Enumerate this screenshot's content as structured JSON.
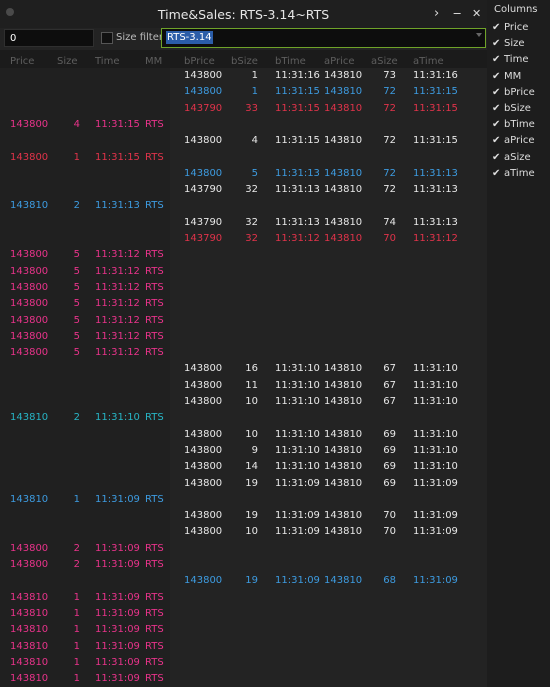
{
  "window": {
    "title": "Time&Sales: RTS-3.14~RTS",
    "chevron": "›",
    "minimize": "‒",
    "close": "✕"
  },
  "toolbar": {
    "price_value": "0",
    "size_filter_label": "Size filter",
    "symbol_value": "RTS-3.14"
  },
  "columns_panel": {
    "title": "Columns",
    "items": [
      {
        "label": "Price",
        "checked": true
      },
      {
        "label": "Size",
        "checked": true
      },
      {
        "label": "Time",
        "checked": true
      },
      {
        "label": "MM",
        "checked": true
      },
      {
        "label": "bPrice",
        "checked": true
      },
      {
        "label": "bSize",
        "checked": true
      },
      {
        "label": "bTime",
        "checked": true
      },
      {
        "label": "aPrice",
        "checked": true
      },
      {
        "label": "aSize",
        "checked": true
      },
      {
        "label": "aTime",
        "checked": true
      }
    ]
  },
  "headers": [
    "Price",
    "Size",
    "Time",
    "MM",
    "bPrice",
    "bSize",
    "bTime",
    "aPrice",
    "aSize",
    "aTime"
  ],
  "colors": {
    "white": "#e8e8e8",
    "blue": "#3d9be0",
    "red": "#e0334a",
    "magenta": "#e8338a",
    "cyan": "#27b4c4"
  },
  "rows": [
    {
      "kind": "q",
      "color": "white",
      "v": [
        "143800",
        "1",
        "11:31:16",
        "143810",
        "73",
        "11:31:16"
      ]
    },
    {
      "kind": "q",
      "color": "blue",
      "v": [
        "143800",
        "1",
        "11:31:15",
        "143810",
        "72",
        "11:31:15"
      ]
    },
    {
      "kind": "q",
      "color": "red",
      "v": [
        "143790",
        "33",
        "11:31:15",
        "143810",
        "72",
        "11:31:15"
      ]
    },
    {
      "kind": "t",
      "color": "magenta",
      "v": [
        "143800",
        "4",
        "11:31:15",
        "RTS"
      ]
    },
    {
      "kind": "q",
      "color": "white",
      "v": [
        "143800",
        "4",
        "11:31:15",
        "143810",
        "72",
        "11:31:15"
      ]
    },
    {
      "kind": "t",
      "color": "red",
      "v": [
        "143800",
        "1",
        "11:31:15",
        "RTS"
      ]
    },
    {
      "kind": "q",
      "color": "blue",
      "v": [
        "143800",
        "5",
        "11:31:13",
        "143810",
        "72",
        "11:31:13"
      ]
    },
    {
      "kind": "q",
      "color": "white",
      "v": [
        "143790",
        "32",
        "11:31:13",
        "143810",
        "72",
        "11:31:13"
      ]
    },
    {
      "kind": "t",
      "color": "blue",
      "v": [
        "143810",
        "2",
        "11:31:13",
        "RTS"
      ]
    },
    {
      "kind": "q",
      "color": "white",
      "v": [
        "143790",
        "32",
        "11:31:13",
        "143810",
        "74",
        "11:31:13"
      ]
    },
    {
      "kind": "q",
      "color": "red",
      "v": [
        "143790",
        "32",
        "11:31:12",
        "143810",
        "70",
        "11:31:12"
      ]
    },
    {
      "kind": "t",
      "color": "magenta",
      "v": [
        "143800",
        "5",
        "11:31:12",
        "RTS"
      ]
    },
    {
      "kind": "t",
      "color": "magenta",
      "v": [
        "143800",
        "5",
        "11:31:12",
        "RTS"
      ]
    },
    {
      "kind": "t",
      "color": "magenta",
      "v": [
        "143800",
        "5",
        "11:31:12",
        "RTS"
      ]
    },
    {
      "kind": "t",
      "color": "magenta",
      "v": [
        "143800",
        "5",
        "11:31:12",
        "RTS"
      ]
    },
    {
      "kind": "t",
      "color": "magenta",
      "v": [
        "143800",
        "5",
        "11:31:12",
        "RTS"
      ]
    },
    {
      "kind": "t",
      "color": "magenta",
      "v": [
        "143800",
        "5",
        "11:31:12",
        "RTS"
      ]
    },
    {
      "kind": "t",
      "color": "magenta",
      "v": [
        "143800",
        "5",
        "11:31:12",
        "RTS"
      ]
    },
    {
      "kind": "q",
      "color": "white",
      "v": [
        "143800",
        "16",
        "11:31:10",
        "143810",
        "67",
        "11:31:10"
      ]
    },
    {
      "kind": "q",
      "color": "white",
      "v": [
        "143800",
        "11",
        "11:31:10",
        "143810",
        "67",
        "11:31:10"
      ]
    },
    {
      "kind": "q",
      "color": "white",
      "v": [
        "143800",
        "10",
        "11:31:10",
        "143810",
        "67",
        "11:31:10"
      ]
    },
    {
      "kind": "t",
      "color": "cyan",
      "v": [
        "143810",
        "2",
        "11:31:10",
        "RTS"
      ]
    },
    {
      "kind": "q",
      "color": "white",
      "v": [
        "143800",
        "10",
        "11:31:10",
        "143810",
        "69",
        "11:31:10"
      ]
    },
    {
      "kind": "q",
      "color": "white",
      "v": [
        "143800",
        "9",
        "11:31:10",
        "143810",
        "69",
        "11:31:10"
      ]
    },
    {
      "kind": "q",
      "color": "white",
      "v": [
        "143800",
        "14",
        "11:31:10",
        "143810",
        "69",
        "11:31:10"
      ]
    },
    {
      "kind": "q",
      "color": "white",
      "v": [
        "143800",
        "19",
        "11:31:09",
        "143810",
        "69",
        "11:31:09"
      ]
    },
    {
      "kind": "t",
      "color": "blue",
      "v": [
        "143810",
        "1",
        "11:31:09",
        "RTS"
      ]
    },
    {
      "kind": "q",
      "color": "white",
      "v": [
        "143800",
        "19",
        "11:31:09",
        "143810",
        "70",
        "11:31:09"
      ]
    },
    {
      "kind": "q",
      "color": "white",
      "v": [
        "143800",
        "10",
        "11:31:09",
        "143810",
        "70",
        "11:31:09"
      ]
    },
    {
      "kind": "t",
      "color": "magenta",
      "v": [
        "143800",
        "2",
        "11:31:09",
        "RTS"
      ]
    },
    {
      "kind": "t",
      "color": "magenta",
      "v": [
        "143800",
        "2",
        "11:31:09",
        "RTS"
      ]
    },
    {
      "kind": "q",
      "color": "blue",
      "v": [
        "143800",
        "19",
        "11:31:09",
        "143810",
        "68",
        "11:31:09"
      ]
    },
    {
      "kind": "t",
      "color": "magenta",
      "v": [
        "143810",
        "1",
        "11:31:09",
        "RTS"
      ]
    },
    {
      "kind": "t",
      "color": "magenta",
      "v": [
        "143810",
        "1",
        "11:31:09",
        "RTS"
      ]
    },
    {
      "kind": "t",
      "color": "magenta",
      "v": [
        "143810",
        "1",
        "11:31:09",
        "RTS"
      ]
    },
    {
      "kind": "t",
      "color": "magenta",
      "v": [
        "143810",
        "1",
        "11:31:09",
        "RTS"
      ]
    },
    {
      "kind": "t",
      "color": "magenta",
      "v": [
        "143810",
        "1",
        "11:31:09",
        "RTS"
      ]
    },
    {
      "kind": "t",
      "color": "magenta",
      "v": [
        "143810",
        "1",
        "11:31:09",
        "RTS"
      ]
    }
  ]
}
